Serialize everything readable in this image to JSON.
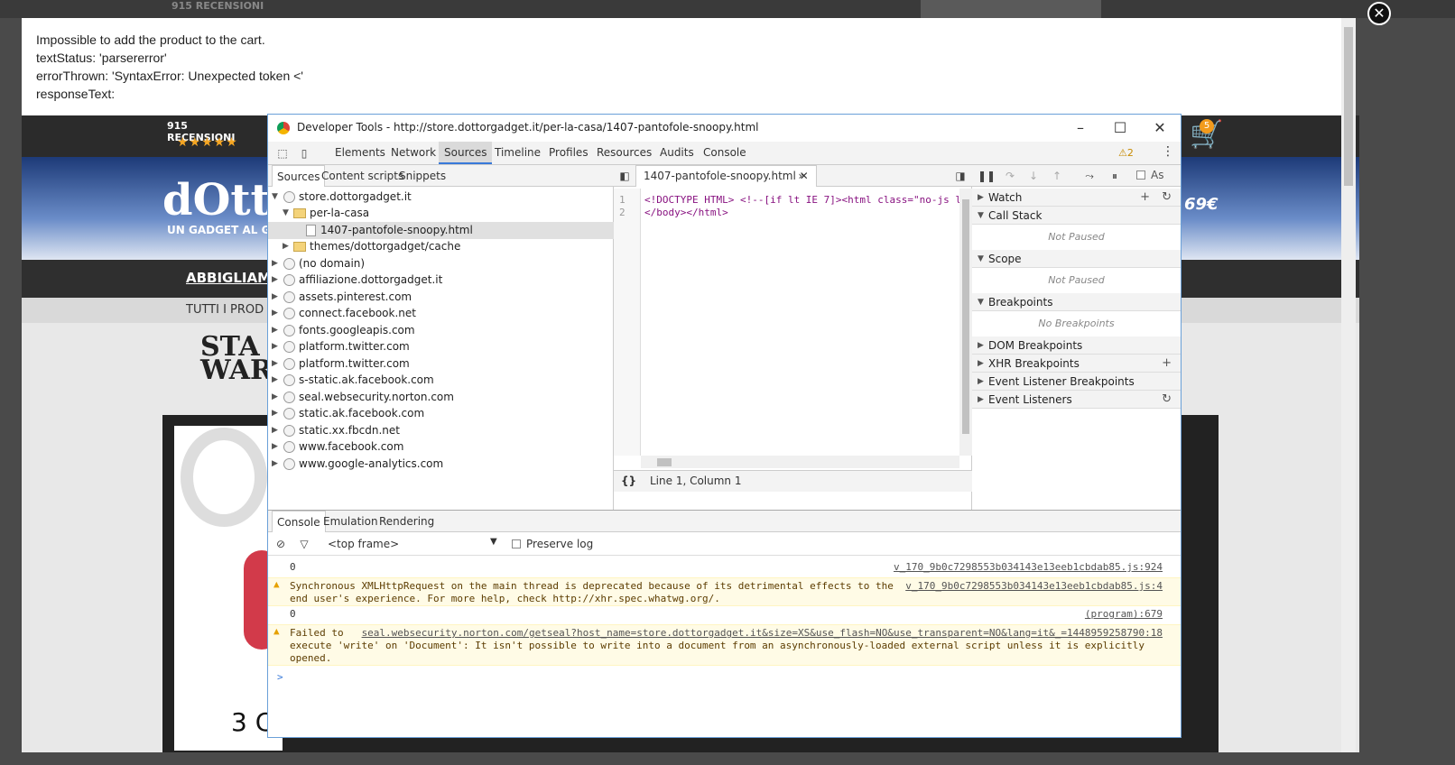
{
  "background": {
    "reviews": "915 RECENSIONI",
    "stars": "★★★★★",
    "logo": "dOtt",
    "tagline": "UN GADGET AL G",
    "price": "69€",
    "nav_item": "ABBIGLIAM",
    "subnav_item": "TUTTI I PROD",
    "starwars": "STA\nWAR",
    "product_text": "3 C",
    "cart_count": "5"
  },
  "error": {
    "line1": "Impossible to add the product to the cart.",
    "line2": "textStatus: 'parsererror'",
    "line3": "errorThrown: 'SyntaxError: Unexpected token <'",
    "line4": "responseText:"
  },
  "devtools": {
    "title": "Developer Tools - http://store.dottorgadget.it/per-la-casa/1407-pantofole-snoopy.html",
    "tabs": [
      "Elements",
      "Network",
      "Sources",
      "Timeline",
      "Profiles",
      "Resources",
      "Audits",
      "Console"
    ],
    "warning_count": "⚠2",
    "navigator_tabs": [
      "Sources",
      "Content scripts",
      "Snippets"
    ],
    "tree": [
      "store.dottorgadget.it",
      "per-la-casa",
      "1407-pantofole-snoopy.html",
      "themes/dottorgadget/cache",
      "(no domain)",
      "affiliazione.dottorgadget.it",
      "assets.pinterest.com",
      "connect.facebook.net",
      "fonts.googleapis.com",
      "platform.twitter.com",
      "platform.twitter.com",
      "s-static.ak.facebook.com",
      "seal.websecurity.norton.com",
      "static.ak.facebook.com",
      "static.xx.fbcdn.net",
      "www.facebook.com",
      "www.google-analytics.com"
    ],
    "editor_tab": "1407-pantofole-snoopy.html",
    "code_lines": [
      "<!DOCTYPE HTML> <!--[if lt IE 7]><html class=\"no-js lt",
      "</body></html>"
    ],
    "line_numbers": [
      "1",
      "2"
    ],
    "cursor_status": "Line 1, Column 1",
    "pretty_print": "{}",
    "right_panel": {
      "async_label": "As",
      "sections": [
        "Watch",
        "Call Stack",
        "Scope",
        "Breakpoints",
        "DOM Breakpoints",
        "XHR Breakpoints",
        "Event Listener Breakpoints",
        "Event Listeners"
      ],
      "not_paused": "Not Paused",
      "no_breakpoints": "No Breakpoints"
    },
    "drawer_tabs": [
      "Console",
      "Emulation",
      "Rendering"
    ],
    "frame_select": "<top frame>",
    "preserve_log": "Preserve log",
    "console": [
      {
        "text": "0",
        "src": "v_170_9b0c7298553b034143e13eeb1cbdab85.js:924"
      },
      {
        "text": "Synchronous XMLHttpRequest on the main thread is deprecated because of its detrimental effects to the",
        "text2": "end user's experience. For more help, check http://xhr.spec.whatwg.org/.",
        "src": "v_170_9b0c7298553b034143e13eeb1cbdab85.js:4"
      },
      {
        "text": "0",
        "src": "(program):679"
      },
      {
        "text": "Failed to",
        "src": "seal.websecurity.norton.com/getseal?host_name=store.dottorgadget.it&size=XS&use_flash=NO&use_transparent=NO&lang=it&_=1448959258790:18",
        "text2": "execute 'write' on 'Document': It isn't possible to write into a document from an asynchronously-loaded external script unless it is explicitly",
        "text3": "opened."
      }
    ],
    "prompt": ">"
  }
}
